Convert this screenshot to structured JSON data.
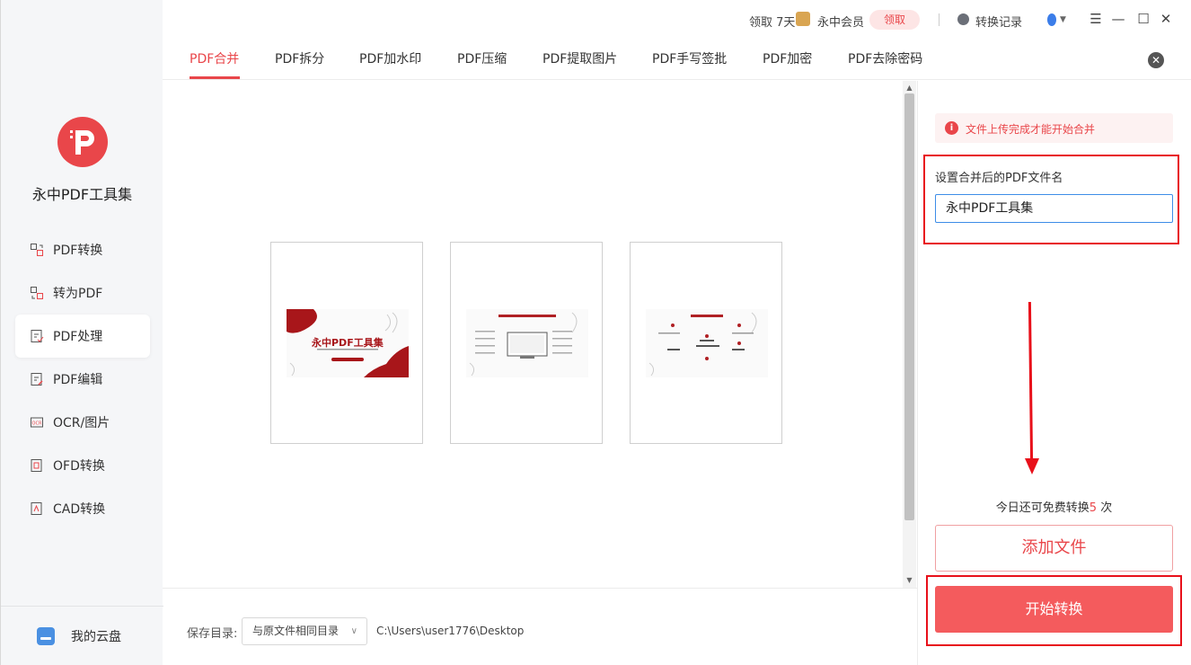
{
  "app": {
    "name": "永中PDF工具集"
  },
  "sidebar": {
    "items": [
      {
        "label": "PDF转换"
      },
      {
        "label": "转为PDF"
      },
      {
        "label": "PDF处理"
      },
      {
        "label": "PDF编辑"
      },
      {
        "label": "OCR/图片"
      },
      {
        "label": "OFD转换"
      },
      {
        "label": "CAD转换"
      }
    ],
    "cloud_label": "我的云盘"
  },
  "titlebar": {
    "promo": "领取 7天",
    "member": "永中会员",
    "claim": "领取",
    "history": "转换记录"
  },
  "tabs": [
    {
      "label": "PDF合并"
    },
    {
      "label": "PDF拆分"
    },
    {
      "label": "PDF加水印"
    },
    {
      "label": "PDF压缩"
    },
    {
      "label": "PDF提取图片"
    },
    {
      "label": "PDF手写签批"
    },
    {
      "label": "PDF加密"
    },
    {
      "label": "PDF去除密码"
    }
  ],
  "preview": {
    "page1_title": "永中PDF工具集"
  },
  "footer": {
    "save_label": "保存目录:",
    "save_option": "与原文件相同目录",
    "save_path": "C:\\Users\\user1776\\Desktop"
  },
  "panel": {
    "notice": "文件上传完成才能开始合并",
    "name_label": "设置合并后的PDF文件名",
    "name_value": "永中PDF工具集",
    "free_prefix": "今日还可免费转换",
    "free_num": "5",
    "free_suffix": " 次",
    "add_button": "添加文件",
    "start_button": "开始转换"
  },
  "colors": {
    "accent": "#e9464a",
    "highlight_box": "#e8101a"
  }
}
